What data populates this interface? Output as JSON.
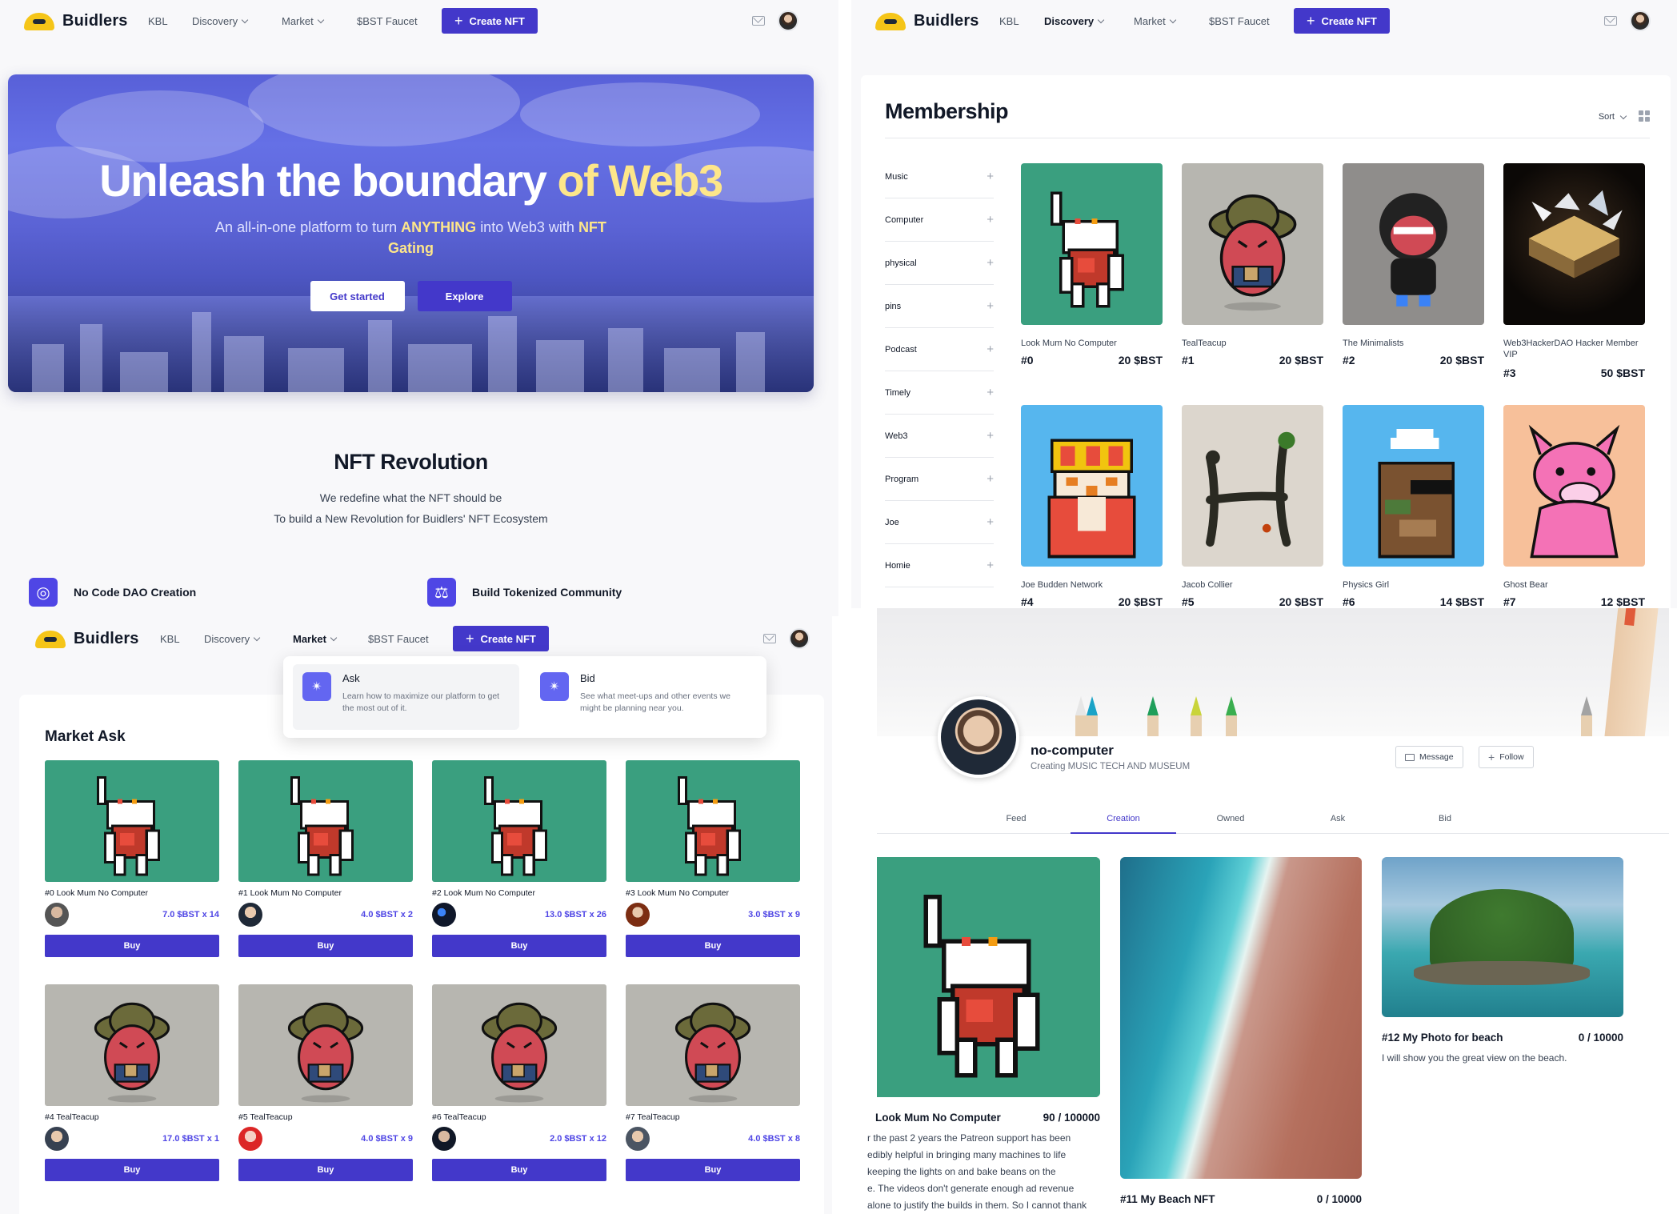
{
  "colors": {
    "accent": "#4338ca",
    "hero_highlight": "#fde68a",
    "price": "#4f46e5"
  },
  "brand": {
    "name": "Buidlers"
  },
  "nav": {
    "kbl": "KBL",
    "discovery": "Discovery",
    "market": "Market",
    "faucet": "$BST Faucet",
    "create": "Create NFT",
    "icons": [
      "mail-icon",
      "user-avatar"
    ]
  },
  "home": {
    "hero_title_main": "Unleash the boundary",
    "hero_title_accent": "of Web3",
    "hero_sub_1": "An all-in-one platform to turn",
    "hero_sub_anything": "ANYTHING",
    "hero_sub_2": "into Web3 with",
    "hero_sub_nft": "NFT",
    "hero_sub_gating": "Gating",
    "btn_started": "Get started",
    "btn_explore": "Explore",
    "rev_title": "NFT Revolution",
    "rev_line1": "We redefine what the NFT should be",
    "rev_line2": "To build a New Revolution for Buidlers' NFT Ecosystem",
    "feature1": "No Code DAO Creation",
    "feature2": "Build Tokenized Community"
  },
  "membership": {
    "title": "Membership",
    "sort": "Sort",
    "categories": [
      "Music",
      "Computer",
      "physical",
      "pins",
      "Podcast",
      "Timely",
      "Web3",
      "Program",
      "Joe",
      "Homie"
    ],
    "items": [
      {
        "name": "Look Mum No Computer",
        "id": "#0",
        "price": "20 $BST"
      },
      {
        "name": "TealTeacup",
        "id": "#1",
        "price": "20 $BST"
      },
      {
        "name": "The Minimalists",
        "id": "#2",
        "price": "20 $BST"
      },
      {
        "name": "Web3HackerDAO Hacker Member VIP",
        "id": "#3",
        "price": "50 $BST"
      },
      {
        "name": "Joe Budden Network",
        "id": "#4",
        "price": "20 $BST"
      },
      {
        "name": "Jacob Collier",
        "id": "#5",
        "price": "20 $BST"
      },
      {
        "name": "Physics Girl",
        "id": "#6",
        "price": "14 $BST"
      },
      {
        "name": "Ghost Bear",
        "id": "#7",
        "price": "12 $BST"
      }
    ]
  },
  "market": {
    "title": "Market Ask",
    "dd_ask_title": "Ask",
    "dd_ask_desc": "Learn how to maximize our platform to get the most out of it.",
    "dd_bid_title": "Bid",
    "dd_bid_desc": "See what meet-ups and other events we might be planning near you.",
    "buy": "Buy",
    "items": [
      {
        "name": "#0 Look Mum No Computer",
        "price": "7.0 $BST x 14"
      },
      {
        "name": "#1 Look Mum No Computer",
        "price": "4.0 $BST x 2"
      },
      {
        "name": "#2 Look Mum No Computer",
        "price": "13.0 $BST x 26"
      },
      {
        "name": "#3 Look Mum No Computer",
        "price": "3.0 $BST x 9"
      },
      {
        "name": "#4 TealTeacup",
        "price": "17.0 $BST x 1"
      },
      {
        "name": "#5 TealTeacup",
        "price": "4.0 $BST x 9"
      },
      {
        "name": "#6 TealTeacup",
        "price": "2.0 $BST x 12"
      },
      {
        "name": "#7 TealTeacup",
        "price": "4.0 $BST x 8"
      }
    ]
  },
  "profile": {
    "name": "no-computer",
    "subtitle": "Creating MUSIC TECH AND MUSEUM",
    "message": "Message",
    "follow": "Follow",
    "tabs": [
      "Feed",
      "Creation",
      "Owned",
      "Ask",
      "Bid"
    ],
    "items": [
      {
        "name": "Look Mum No Computer",
        "count": "90 / 100000",
        "desc_lines": [
          "r the past 2 years the Patreon support has been",
          "edibly helpful in bringing many machines to life",
          "keeping the lights on and bake beans on the",
          "e. The videos don't generate enough ad revenue",
          "alone to justify the builds in them. So I cannot thank"
        ]
      },
      {
        "name": "#11 My Beach NFT",
        "count": "0 / 10000"
      },
      {
        "name": "#12 My Photo for beach",
        "count": "0 / 10000",
        "desc": "I will show you the great view on the beach."
      }
    ]
  }
}
